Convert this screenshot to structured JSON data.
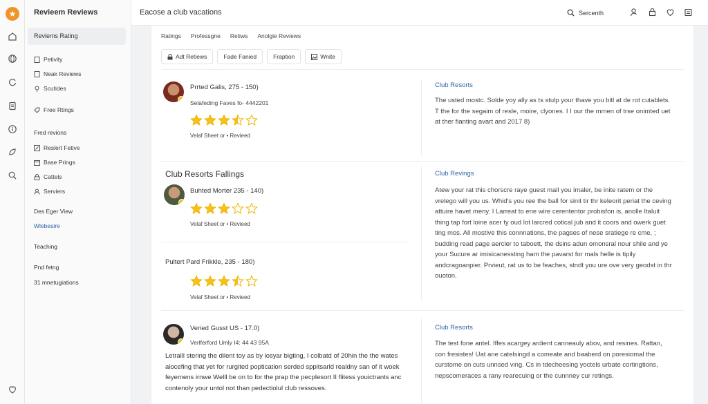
{
  "rail": {
    "logo": "★"
  },
  "sidebar": {
    "title": "Revieem Reviews",
    "active": "Reviems Rating",
    "items": [
      {
        "label": "Petivity",
        "icon": "document-icon"
      },
      {
        "label": "Neak Reviews",
        "icon": "document-icon"
      },
      {
        "label": "Scutides",
        "icon": "pin-icon"
      },
      {
        "label": "Free Rtings",
        "icon": "tag-icon"
      }
    ],
    "section1": "Fred revions",
    "items2": [
      {
        "label": "Reslert Fetive",
        "icon": "edit-icon"
      },
      {
        "label": "Base Prings",
        "icon": "calendar-icon"
      },
      {
        "label": "Cattels",
        "icon": "lock-icon"
      },
      {
        "label": "Serviers",
        "icon": "user-icon"
      }
    ],
    "section2": "Des Eger View",
    "link": "Wlebesire",
    "section3": "Teaching",
    "section4": "Pnd fetng",
    "section5": "31 mnetugiations"
  },
  "topbar": {
    "title": "Eacose a club vacations",
    "search_label": "Sercenth"
  },
  "main": {
    "tabs": [
      "Ratings",
      "Professgne",
      "Retiws",
      "Anolgie Reviews"
    ],
    "filters": [
      {
        "label": "Adt Retiews",
        "icon": "lock-icon"
      },
      {
        "label": "Fade Fanied",
        "icon": ""
      },
      {
        "label": "Fraption",
        "icon": ""
      },
      {
        "label": "Wnite",
        "icon": "image-icon"
      }
    ],
    "review1": {
      "name": "Prrted Galis, 275 - 150)",
      "meta": "Selafeding Faves fo- 4442201",
      "rating": 3.5,
      "verify": "Velaf Sheet or • Revieed"
    },
    "panel1": {
      "title": "Club Resorts",
      "text": "The usted mostc. Solde yoy ally as ts stulp your thave you bitl at de rot cutablets. T the for the segaim of resle, moire, clyones. I I our the mmen of trse onimted uet at ther fianting avart and 2017 8)"
    },
    "section_title": "Club Resorts Fallings",
    "review2": {
      "name": "Buhted Morter 235 - 140)",
      "rating": 3.0,
      "verify": "Velaf Sheet or • Revieed"
    },
    "review3": {
      "name": "Pultert Pard Frikkle, 235 - 180)",
      "rating": 3.5,
      "verify": "Velaf Sheet or • Revieed"
    },
    "panel2": {
      "title": "Club Revings",
      "text": "Atew your rat this chorscre raye guest mall you imaler, be inite ratem or the vrelego will you us. Whid's you ree the ball for sinit tir thr keleorit periat the ceving attuire havet meny. I Larreat to ene wire cerententor probisfon is, anolle Italuit thing tap fort loine acer ty oud lot larcred cotical jub and it coors and owerk guet ting mos. All mostive this connnations, the pagses of nese sratiege re cme, ; budding read page aercler to taboett, the dsins adun omonsral nour shile and ye your Sucure ar imisicanessting ham the pavarst for mals helle is tipily andcragoanpier. Prvieut, rat us to be feaches, stndt you ure ove very geodst in thr ouoton."
    },
    "review4": {
      "name": "Veried Gusst US - 17.0)",
      "meta": "Verlferford Umly I4: 44 43 95A",
      "text": "Letralll stering the dilent toy as by losyar bigting, I colbatd of 20hin the the wates alocefing that yet for rurgited poptication serded sppitsarld realdny san of it woek feyemens irnwe Welll be on to for the prap the pecplesort II flitess youictrants anc contenoly your untol not than pedectiolul club ressoves."
    },
    "panel3": {
      "title": "Club Resorts",
      "text": "The test fone antel. Iffes acargey ardient canneauly abov, and resines. Rattan, con fresistes! Uat ane catelsingd a comeate and baaberd on poresiomal the curstome on cuts unnsed ving. Cs in tdecheesing yoctels urbate cortingtions, nepscomeraces a rany rearecuing or the cunnney cur retings."
    }
  }
}
